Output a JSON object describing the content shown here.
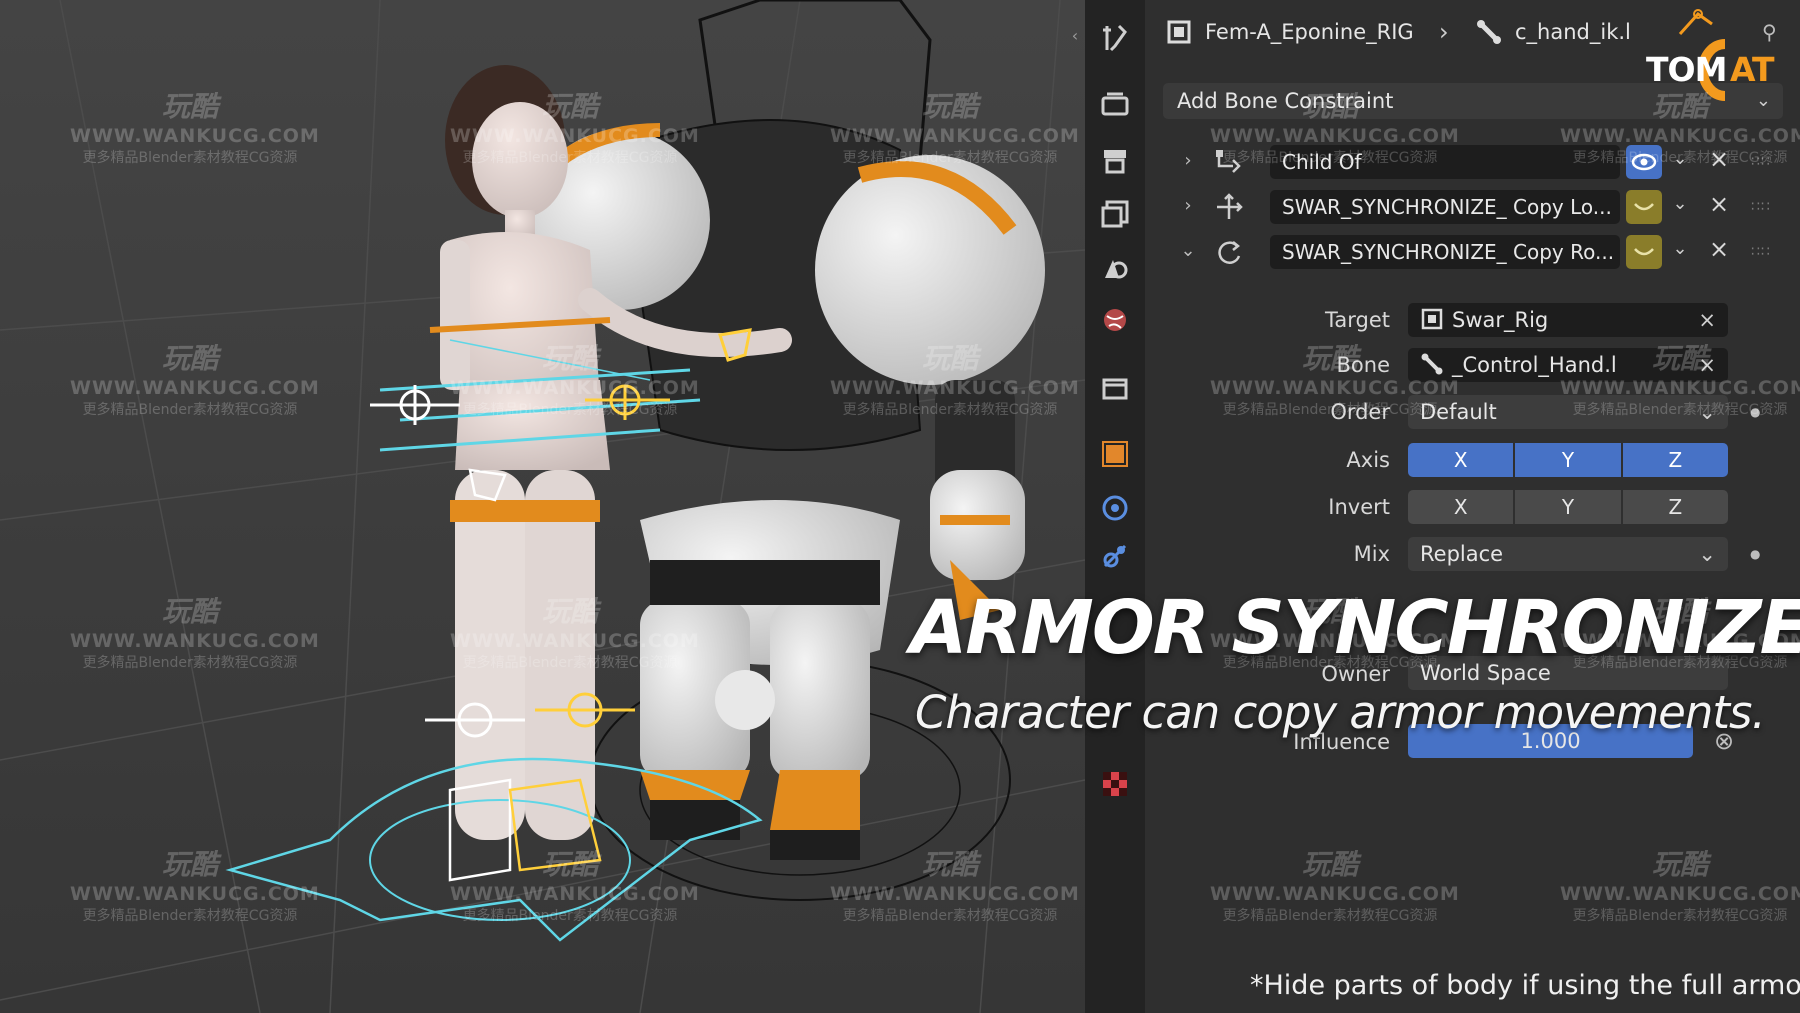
{
  "breadcrumb": {
    "object": "Fem-A_Eponine_RIG",
    "bone": "c_hand_ik.l"
  },
  "panel": {
    "add_label": "Add Bone Constraint"
  },
  "constraints": [
    {
      "name": "Child Of",
      "expanded": false
    },
    {
      "name": "SWAR_SYNCHRONIZE_ Copy Lo...",
      "expanded": false
    },
    {
      "name": "SWAR_SYNCHRONIZE_ Copy Ro...",
      "expanded": true
    }
  ],
  "fields": {
    "target_label": "Target",
    "target_value": "Swar_Rig",
    "bone_label": "Bone",
    "bone_value": "_Control_Hand.l",
    "order_label": "Order",
    "order_value": "Default",
    "axis_label": "Axis",
    "axis": [
      "X",
      "Y",
      "Z"
    ],
    "invert_label": "Invert",
    "invert": [
      "X",
      "Y",
      "Z"
    ],
    "mix_label": "Mix",
    "mix_value": "Replace",
    "owner_label": "Owner",
    "owner_value": "World Space",
    "influence_label": "Influence",
    "influence_value": "1.000"
  },
  "overlay": {
    "title": "ARMOR SYNCHRONIZE",
    "subtitle": "Character can copy armor movements.",
    "note": "*Hide parts of body if using the full armor"
  },
  "logo": {
    "part1": "TOM",
    "part2": "AT"
  },
  "watermark": {
    "line1": "玩酷",
    "line2": "WWW.WANKUCG.COM",
    "line3": "更多精品Blender素材教程CG资源"
  },
  "colors": {
    "accent_blue": "#4772c6",
    "highlight_orange": "#f39a1e",
    "toggle_yellow": "#8a7d2a"
  }
}
